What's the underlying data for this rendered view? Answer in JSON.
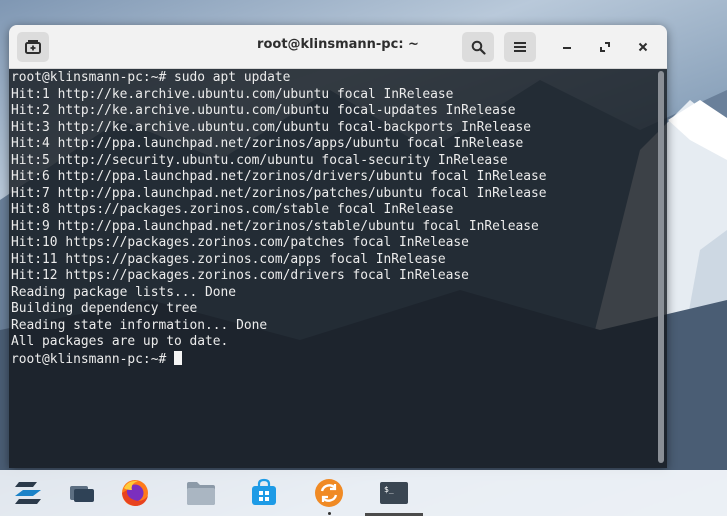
{
  "window": {
    "title": "root@klinsmann-pc: ~",
    "controls": [
      "new-tab-icon",
      "search-icon",
      "menu-icon",
      "minimize-icon",
      "maximize-icon",
      "close-icon"
    ]
  },
  "terminal": {
    "lines": [
      "root@klinsmann-pc:~# sudo apt update",
      "Hit:1 http://ke.archive.ubuntu.com/ubuntu focal InRelease",
      "Hit:2 http://ke.archive.ubuntu.com/ubuntu focal-updates InRelease",
      "Hit:3 http://ke.archive.ubuntu.com/ubuntu focal-backports InRelease",
      "Hit:4 http://ppa.launchpad.net/zorinos/apps/ubuntu focal InRelease",
      "Hit:5 http://security.ubuntu.com/ubuntu focal-security InRelease",
      "Hit:6 http://ppa.launchpad.net/zorinos/drivers/ubuntu focal InRelease",
      "Hit:7 http://ppa.launchpad.net/zorinos/patches/ubuntu focal InRelease",
      "Hit:8 https://packages.zorinos.com/stable focal InRelease",
      "Hit:9 http://ppa.launchpad.net/zorinos/stable/ubuntu focal InRelease",
      "Hit:10 https://packages.zorinos.com/patches focal InRelease",
      "Hit:11 https://packages.zorinos.com/apps focal InRelease",
      "Hit:12 https://packages.zorinos.com/drivers focal InRelease",
      "Reading package lists... Done",
      "Building dependency tree",
      "Reading state information... Done",
      "All packages are up to date."
    ],
    "prompt": "root@klinsmann-pc:~# "
  },
  "taskbar": {
    "items": [
      "zorin-menu-icon",
      "workspaces-icon",
      "firefox-icon",
      "files-icon",
      "software-store-icon",
      "updates-icon",
      "terminal-icon"
    ],
    "terminal_icon_label": "$_",
    "active_item": "terminal-icon"
  }
}
